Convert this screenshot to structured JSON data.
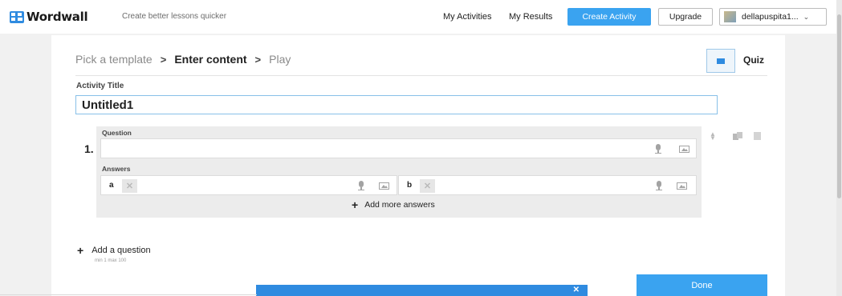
{
  "topbar": {
    "logo_text": "Wordwall",
    "tagline": "Create better lessons quicker",
    "my_activities": "My Activities",
    "my_results": "My Results",
    "create_activity": "Create Activity",
    "upgrade": "Upgrade",
    "username": "dellapuspita1...",
    "accent": "#3aa3f0"
  },
  "breadcrumb": {
    "step1": "Pick a template",
    "step2": "Enter content",
    "step3": "Play"
  },
  "template": {
    "name": "Quiz",
    "icon": "quiz-template-icon"
  },
  "activity_title": {
    "label": "Activity Title",
    "value": "Untitled1"
  },
  "question": {
    "number": "1.",
    "question_label": "Question",
    "answers_label": "Answers",
    "answers": [
      {
        "letter": "a",
        "value": ""
      },
      {
        "letter": "b",
        "value": ""
      }
    ],
    "add_more_answers": "Add more answers"
  },
  "add_question": {
    "label": "Add a question",
    "limits": "min 1   max 100"
  },
  "done": "Done"
}
